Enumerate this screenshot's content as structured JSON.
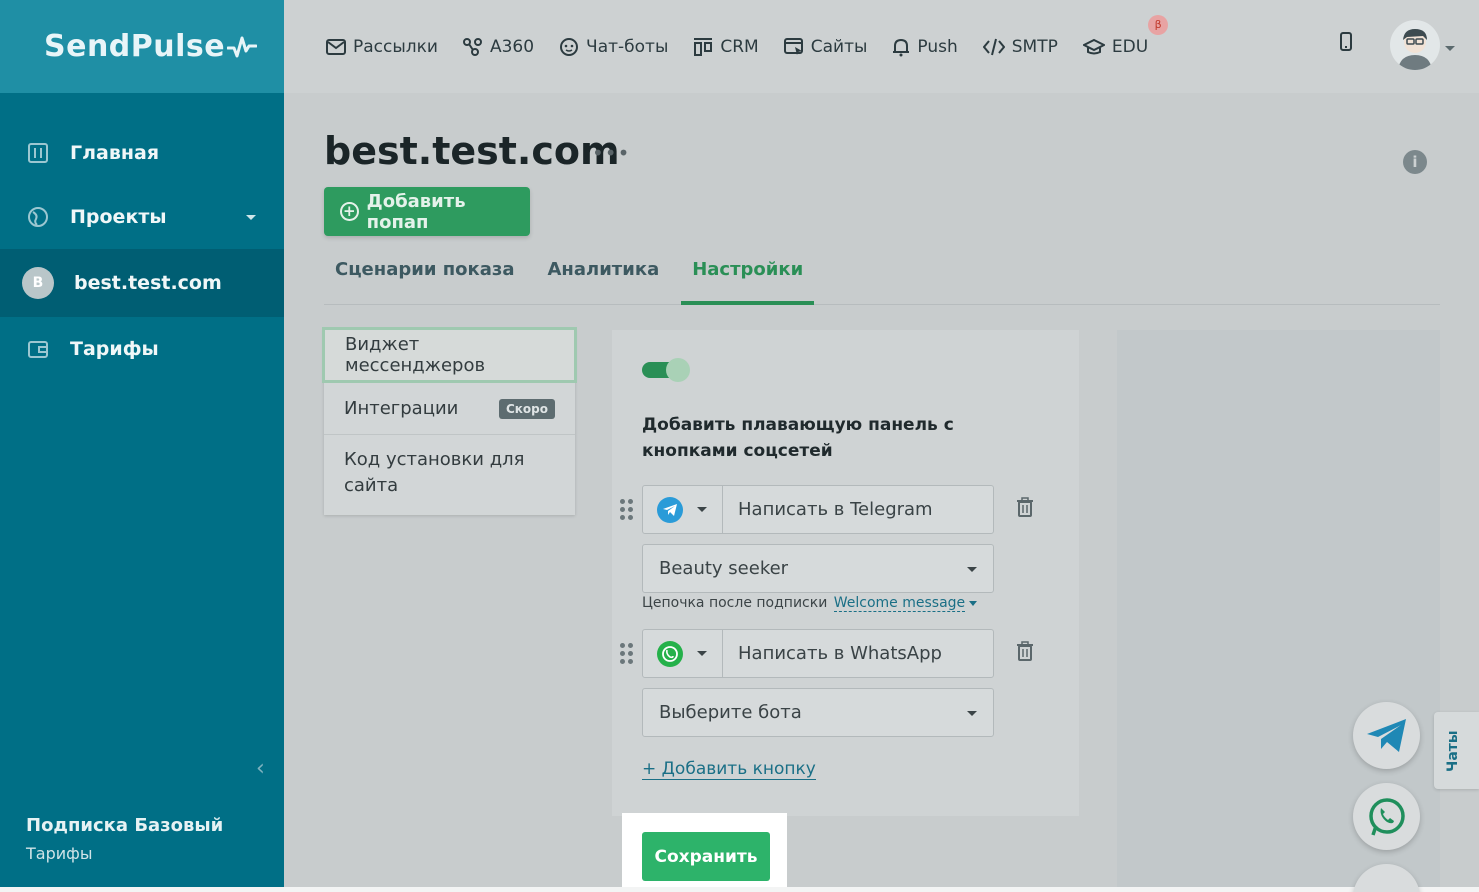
{
  "brand": {
    "name": "SendPulse"
  },
  "topnav": [
    {
      "label": "Рассылки",
      "icon": "mail-icon"
    },
    {
      "label": "A360",
      "icon": "automation-icon"
    },
    {
      "label": "Чат-боты",
      "icon": "chatbot-icon"
    },
    {
      "label": "CRM",
      "icon": "crm-icon"
    },
    {
      "label": "Сайты",
      "icon": "sites-icon"
    },
    {
      "label": "Push",
      "icon": "bell-icon"
    },
    {
      "label": "SMTP",
      "icon": "code-icon"
    },
    {
      "label": "EDU",
      "icon": "graduation-cap-icon",
      "badge": "β"
    }
  ],
  "sidebar": {
    "items": [
      {
        "label": "Главная",
        "icon": "dashboard-icon"
      },
      {
        "label": "Проекты",
        "icon": "globe-icon"
      },
      {
        "label": "best.test.com",
        "avatar": "B"
      },
      {
        "label": "Тарифы",
        "icon": "wallet-icon"
      }
    ],
    "plan_title": "Подписка Базовый",
    "plan_link": "Тарифы"
  },
  "page": {
    "title": "best.test.com",
    "more": "•••",
    "add_popup": "Добавить попап",
    "add_popup_plus": "+",
    "info": "i"
  },
  "tabs": [
    {
      "label": "Сценарии показа",
      "active": false
    },
    {
      "label": "Аналитика",
      "active": false
    },
    {
      "label": "Настройки",
      "active": true
    }
  ],
  "settings_menu": {
    "widget": "Виджет мессенджеров",
    "integrations": "Интеграции",
    "soon": "Скоро",
    "install_code": "Код установки для сайта"
  },
  "widget": {
    "enabled": true,
    "title": "Добавить плавающую панель с кнопками соцсетей",
    "telegram_text": "Написать в Telegram",
    "telegram_bot": "Beauty seeker",
    "chain_label": "Цепочка после подписки",
    "chain_value": "Welcome message",
    "whatsapp_text": "Написать в WhatsApp",
    "whatsapp_bot": "Выберите бота",
    "add_button": "+ Добавить кнопку",
    "save": "Сохранить"
  },
  "chats_tab": "Чаты",
  "colors": {
    "sidebar": "#006f86",
    "accent_green": "#2db36a",
    "link": "#1a6f86",
    "telegram": "#2a9bd8",
    "whatsapp": "#25b14a"
  }
}
